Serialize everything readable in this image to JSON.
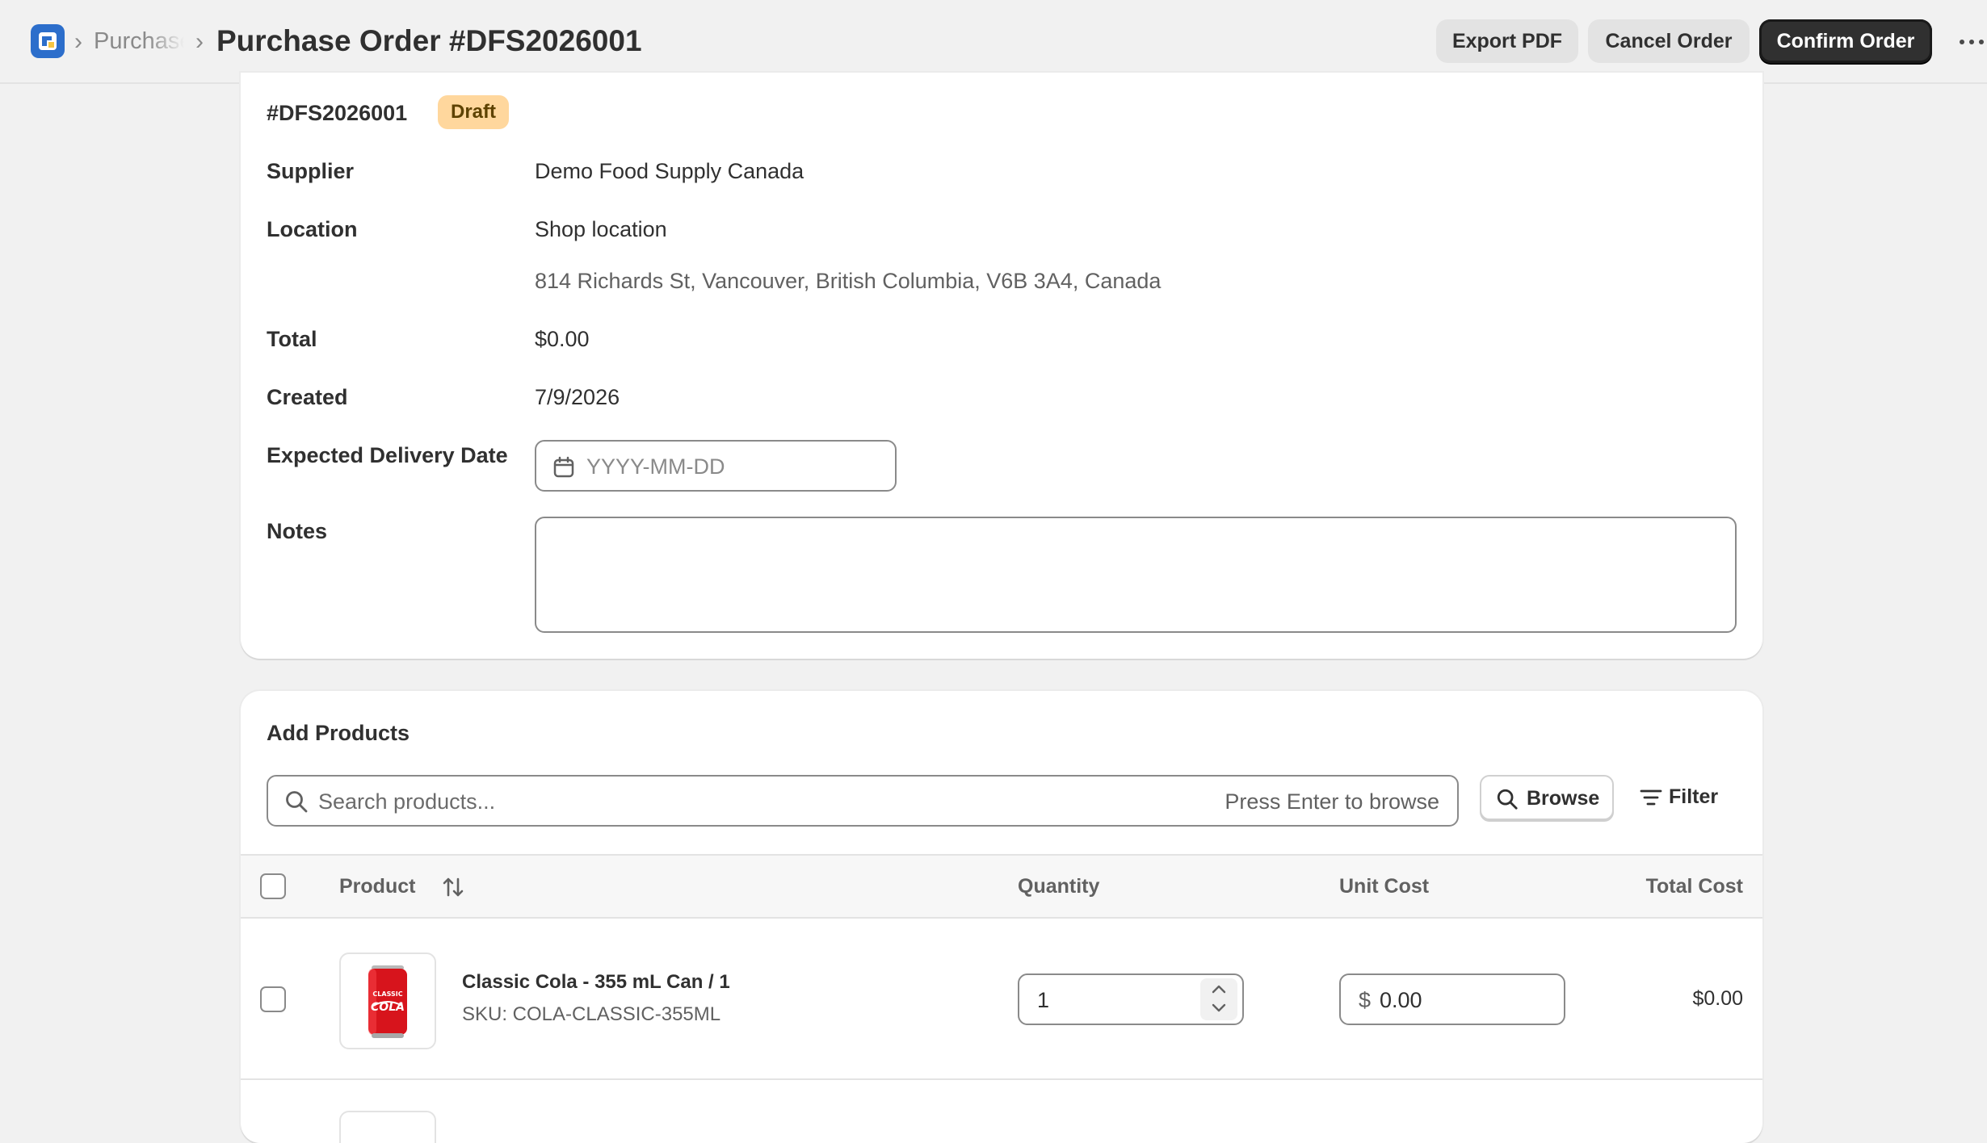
{
  "header": {
    "breadcrumb_parent": "Purchase Orders",
    "title": "Purchase Order #DFS2026001",
    "actions": {
      "export_pdf": "Export PDF",
      "cancel_order": "Cancel Order",
      "confirm_order": "Confirm Order"
    }
  },
  "order": {
    "number": "#DFS2026001",
    "status": "Draft",
    "fields": {
      "supplier_label": "Supplier",
      "supplier_value": "Demo Food Supply Canada",
      "location_label": "Location",
      "location_name": "Shop location",
      "location_address": "814 Richards St, Vancouver, British Columbia, V6B 3A4, Canada",
      "total_label": "Total",
      "total_value": "$0.00",
      "created_label": "Created",
      "created_value": "7/9/2026",
      "delivery_label": "Expected Delivery Date",
      "delivery_placeholder": "YYYY-MM-DD",
      "notes_label": "Notes",
      "notes_value": ""
    }
  },
  "products": {
    "section_title": "Add Products",
    "search_placeholder": "Search products...",
    "search_hint": "Press Enter to browse",
    "browse_label": "Browse",
    "filter_label": "Filter",
    "columns": {
      "product": "Product",
      "quantity": "Quantity",
      "unit_cost": "Unit Cost",
      "total_cost": "Total Cost"
    },
    "rows": [
      {
        "name": "Classic Cola - 355 mL Can / 1",
        "sku": "SKU: COLA-CLASSIC-355ML",
        "quantity": "1",
        "currency": "$",
        "unit_cost": "0.00",
        "total_cost": "$0.00"
      }
    ]
  },
  "colors": {
    "primary_button": "#303030",
    "draft_badge": "#ffd79d",
    "page_background": "#f1f1f1",
    "logo": "#2c6ecb"
  }
}
